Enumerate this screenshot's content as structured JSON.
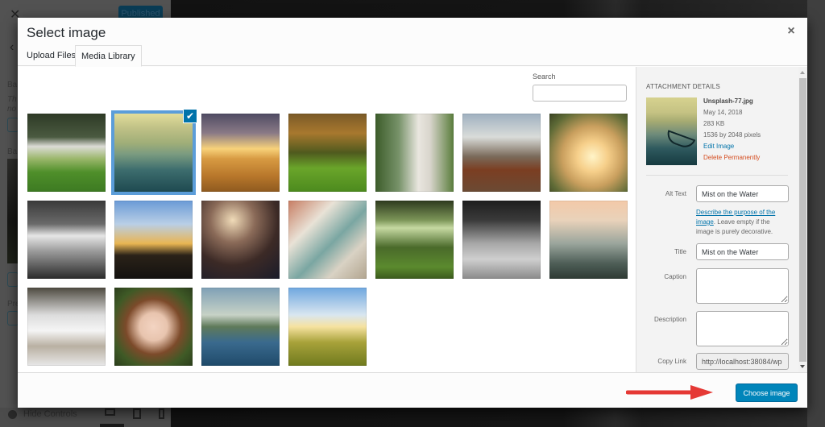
{
  "background": {
    "published_label": "Published",
    "hide_controls_label": "Hide Controls"
  },
  "modal": {
    "title": "Select image",
    "tabs": [
      {
        "label": "Upload Files",
        "active": false
      },
      {
        "label": "Media Library",
        "active": true
      }
    ],
    "search": {
      "label": "Search",
      "value": "",
      "placeholder": ""
    },
    "images": [
      {
        "name": "wedding-lawn-swing",
        "selected": false
      },
      {
        "name": "mist-on-the-water-canoe",
        "selected": true
      },
      {
        "name": "sunset-field",
        "selected": false
      },
      {
        "name": "autumn-forest",
        "selected": false
      },
      {
        "name": "bicycle-dress",
        "selected": false
      },
      {
        "name": "shoes-couple",
        "selected": false
      },
      {
        "name": "girl-sunlight",
        "selected": false
      },
      {
        "name": "bw-coffee-couple",
        "selected": false
      },
      {
        "name": "jumping-silhouette-sunset",
        "selected": false
      },
      {
        "name": "party-lights-crowd",
        "selected": false
      },
      {
        "name": "vintage-van-window",
        "selected": false
      },
      {
        "name": "forest-path-green",
        "selected": false
      },
      {
        "name": "bw-couple-road",
        "selected": false
      },
      {
        "name": "mountain-valley-cliff",
        "selected": false
      },
      {
        "name": "snow-walkers",
        "selected": false
      },
      {
        "name": "woman-lying-grass",
        "selected": false
      },
      {
        "name": "sea-cliff-coast",
        "selected": false
      },
      {
        "name": "sunrise-meadow",
        "selected": false
      }
    ],
    "selected_check_icon": "✔",
    "attachment_details": {
      "heading": "ATTACHMENT DETAILS",
      "filename": "Unsplash-77.jpg",
      "date": "May 14, 2018",
      "size": "283 KB",
      "dimensions": "1536 by 2048 pixels",
      "edit_link": "Edit Image",
      "delete_link": "Delete Permanently",
      "fields": {
        "alt_text": {
          "label": "Alt Text",
          "value": "Mist on the Water"
        },
        "alt_help_link": "Describe the purpose of the image",
        "alt_help_text": ". Leave empty if the image is purely decorative.",
        "title": {
          "label": "Title",
          "value": "Mist on the Water"
        },
        "caption": {
          "label": "Caption",
          "value": ""
        },
        "description": {
          "label": "Description",
          "value": ""
        },
        "copy_link": {
          "label": "Copy Link",
          "value": "http://localhost:38084/wp"
        }
      }
    },
    "close_icon": "×",
    "choose_button": "Choose image",
    "colors": {
      "primary": "#0085ba",
      "link": "#0073aa",
      "delete": "#d54e21",
      "selection": "#5b9dd9",
      "annotation_arrow": "#e53935"
    }
  }
}
